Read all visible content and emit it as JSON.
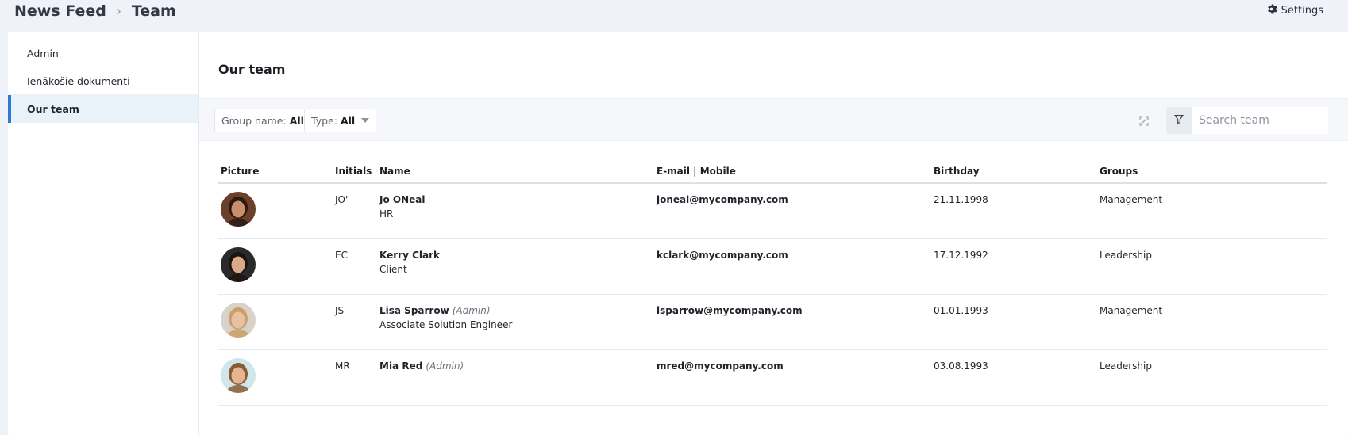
{
  "breadcrumb": {
    "root": "News Feed",
    "separator": "›",
    "current": "Team"
  },
  "settings": {
    "label": "Settings",
    "icon": "gear-icon"
  },
  "sidebar": {
    "items": [
      {
        "label": "Admin",
        "active": false
      },
      {
        "label": "Ienākošie dokumenti",
        "active": false
      },
      {
        "label": "Our team",
        "active": true
      }
    ]
  },
  "main": {
    "title": "Our team",
    "filters": {
      "group": {
        "label": "Group name:",
        "value": "All"
      },
      "type": {
        "label": "Type:",
        "value": "All"
      },
      "search_placeholder": "Search team"
    },
    "columns": {
      "picture": "Picture",
      "initials": "Initials",
      "name": "Name",
      "email": "E-mail | Mobile",
      "birthday": "Birthday",
      "groups": "Groups"
    },
    "rows": [
      {
        "initials": "JO'",
        "name": "Jo ONeal",
        "admin": "",
        "title": "HR",
        "email": "joneal@mycompany.com",
        "birthday": "21.11.1998",
        "group": "Management",
        "avatar_bg": "#6b3f2a",
        "skin": "#c98e6c",
        "hair": "#2a1a12"
      },
      {
        "initials": "EC",
        "name": "Kerry Clark",
        "admin": "",
        "title": "Client",
        "email": "kclark@mycompany.com",
        "birthday": "17.12.1992",
        "group": "Leadership",
        "avatar_bg": "#2a2a2a",
        "skin": "#d9a98a",
        "hair": "#1d1410"
      },
      {
        "initials": "JS",
        "name": "Lisa Sparrow",
        "admin": "(Admin)",
        "title": "Associate Solution Engineer",
        "email": "lsparrow@mycompany.com",
        "birthday": "01.01.1993",
        "group": "Management",
        "avatar_bg": "#d8d2c8",
        "skin": "#e8c0a4",
        "hair": "#c9a06a"
      },
      {
        "initials": "MR",
        "name": "Mia Red",
        "admin": "(Admin)",
        "title": "",
        "email": "mred@mycompany.com",
        "birthday": "03.08.1993",
        "group": "Leadership",
        "avatar_bg": "#cfe6ea",
        "skin": "#e3b592",
        "hair": "#8a5a30"
      }
    ]
  }
}
